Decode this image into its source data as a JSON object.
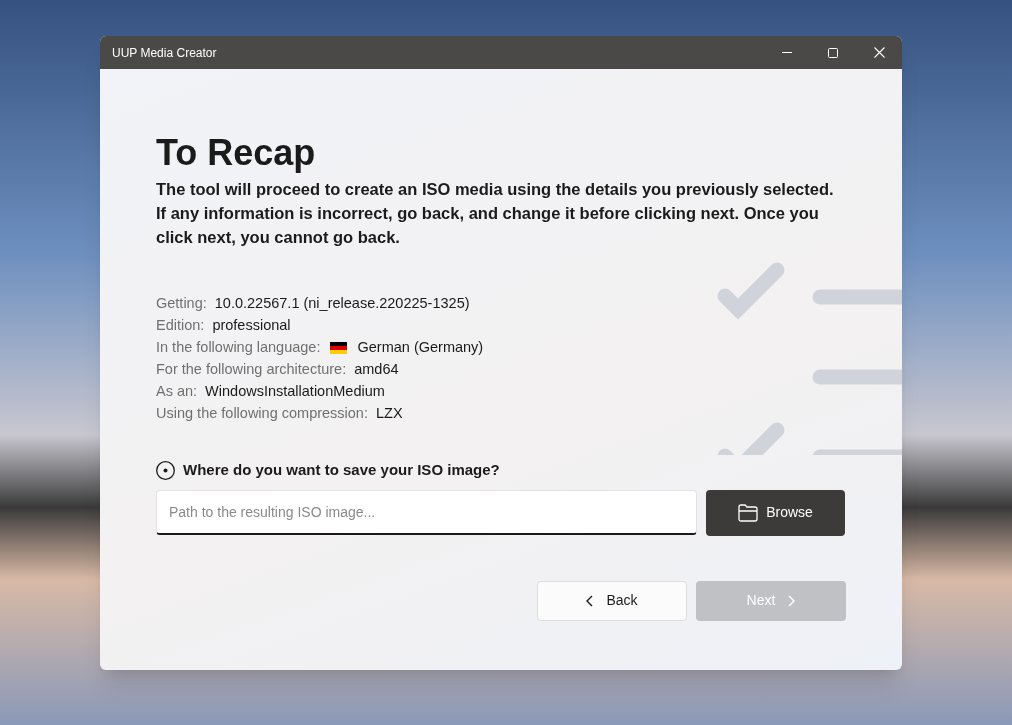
{
  "window": {
    "title": "UUP Media Creator"
  },
  "heading": "To Recap",
  "description": "The tool will proceed to create an ISO media using the details you previously selected. If any information is incorrect, go back, and change it before clicking next. Once you click next, you cannot go back.",
  "details": [
    {
      "label": "Getting:",
      "value": "10.0.22567.1 (ni_release.220225-1325)"
    },
    {
      "label": "Edition:",
      "value": "professional"
    },
    {
      "label": "In the following language:",
      "value": "German (Germany)",
      "kind": "flag"
    },
    {
      "label": "For the following architecture:",
      "value": "amd64"
    },
    {
      "label": "As an:",
      "value": "WindowsInstallationMedium"
    },
    {
      "label": "Using the following compression:",
      "value": "LZX"
    }
  ],
  "save_prompt": "Where do you want to save your ISO image?",
  "path_field": {
    "placeholder": "Path to the resulting ISO image..."
  },
  "browse_button": "Browse",
  "buttons": [
    {
      "label": "Back",
      "kind": "back",
      "disabled": false
    },
    {
      "label": "Next",
      "kind": "next",
      "disabled": true
    }
  ]
}
